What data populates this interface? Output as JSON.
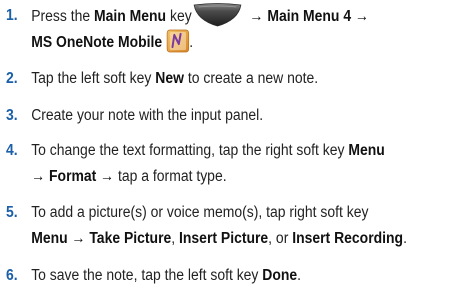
{
  "steps": [
    {
      "number": "1.",
      "line1_a": "Press the ",
      "main_menu_label": "Main Menu",
      "line1_b": " key",
      "line1_c": " → Main Menu 4 →",
      "line2_label": "MS OneNote Mobile",
      "line2_end": ".",
      "icon_key": "main-menu-key-icon",
      "icon_app": "onenote-icon"
    },
    {
      "number": "2.",
      "a": "Tap the left soft key ",
      "b": "New",
      "c": " to create a new note."
    },
    {
      "number": "3.",
      "a": "Create your note with the input panel."
    },
    {
      "number": "4.",
      "l1_a": "To change the text formatting, tap the right soft key ",
      "l1_b": "Menu",
      "l2_a": "→ Format →",
      "l2_b": " tap a format type."
    },
    {
      "number": "5.",
      "l1": "To add a picture(s) or voice memo(s), tap right soft key",
      "l2_a": "Menu → Take Picture",
      "l2_b": ", ",
      "l2_c": "Insert Picture",
      "l2_d": ", or ",
      "l2_e": "Insert Recording",
      "l2_f": "."
    },
    {
      "number": "6.",
      "a": "To save the note, tap the left soft key ",
      "b": "Done",
      "c": "."
    }
  ],
  "colors": {
    "number": "#1a5fa8",
    "text": "#222222"
  }
}
